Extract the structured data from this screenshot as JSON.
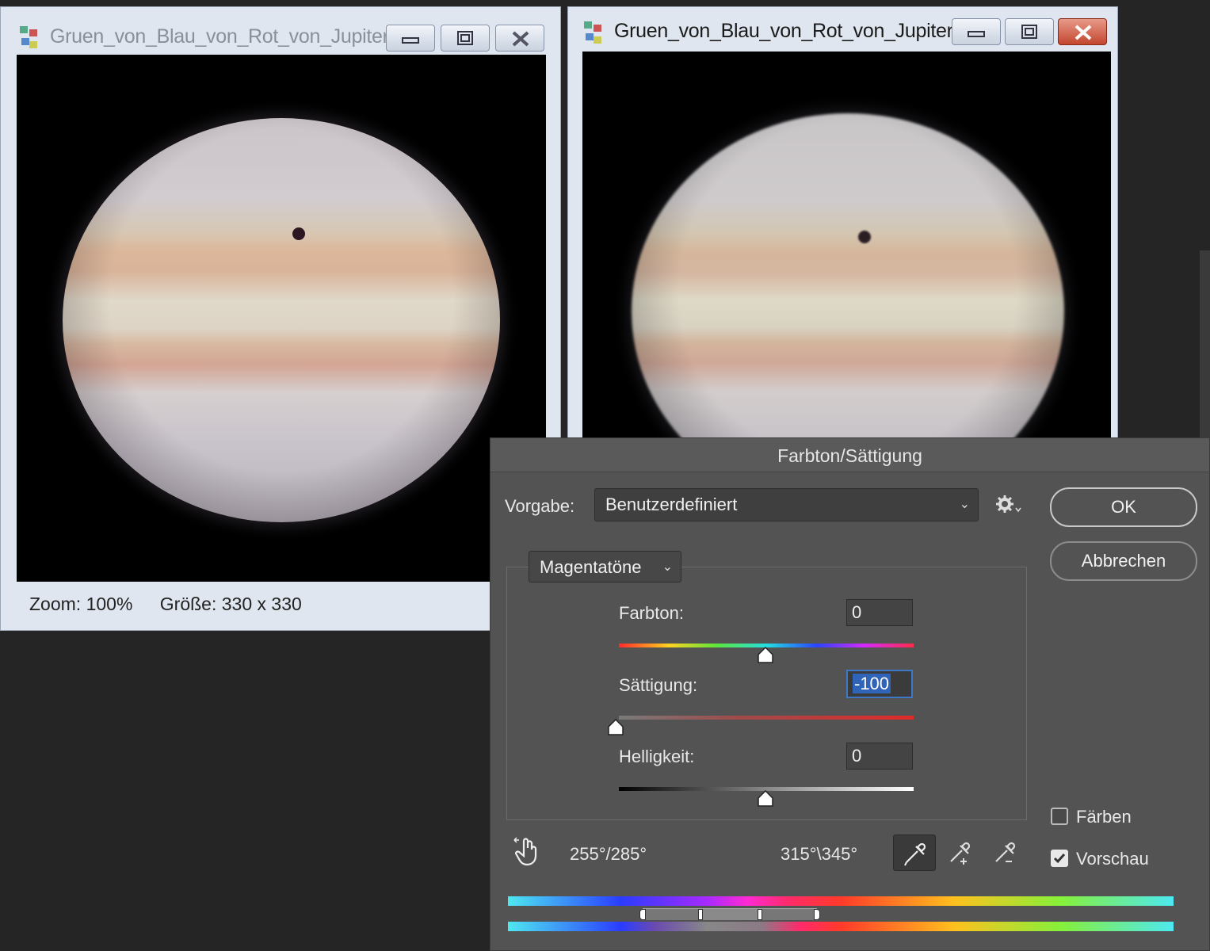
{
  "window_left": {
    "title": "Gruen_von_Blau_von_Rot_von_Jupiter...",
    "status_zoom": "Zoom: 100%",
    "status_size": "Größe: 330 x 330"
  },
  "window_right": {
    "title": "Gruen_von_Blau_von_Rot_von_Jupiter..."
  },
  "dialog": {
    "title": "Farbton/Sättigung",
    "preset_label": "Vorgabe:",
    "preset_value": "Benutzerdefiniert",
    "ok_label": "OK",
    "cancel_label": "Abbrechen",
    "channel_value": "Magentatöne",
    "hue_label": "Farbton:",
    "hue_value": "0",
    "saturation_label": "Sättigung:",
    "saturation_value": "-100",
    "lightness_label": "Helligkeit:",
    "lightness_value": "0",
    "colorize_label": "Färben",
    "colorize_checked": false,
    "preview_label": "Vorschau",
    "preview_checked": true,
    "range_left": "255°/285°",
    "range_right": "315°\\345°"
  },
  "icons": [
    "app-icon",
    "minimize-icon",
    "maximize-icon",
    "close-icon",
    "gear-icon",
    "chevron-down-icon",
    "hand-adjust-icon",
    "eyedropper-icon",
    "eyedropper-plus-icon",
    "eyedropper-minus-icon",
    "checkbox-icon"
  ],
  "colors": {
    "dialog_bg": "#535353",
    "focus_blue": "#2f64b8",
    "close_red": "#c3462e"
  }
}
